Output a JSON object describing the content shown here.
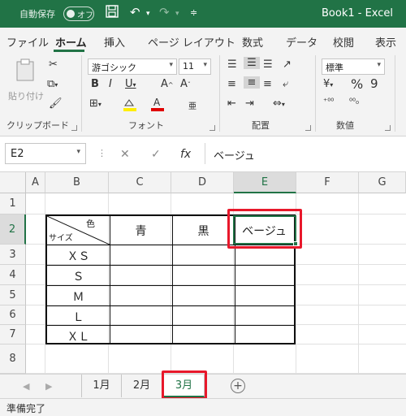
{
  "title_bar": {
    "autosave_label": "自動保存",
    "autosave_state": "オフ",
    "document_title": "Book1 - Excel"
  },
  "ribbon_tabs": [
    "ファイル",
    "ホーム",
    "挿入",
    "ページ レイアウト",
    "数式",
    "データ",
    "校閲",
    "表示"
  ],
  "ribbon": {
    "clipboard": {
      "paste_label": "貼り付け",
      "group_label": "クリップボード"
    },
    "font": {
      "font_name": "游ゴシック",
      "font_size": "11",
      "group_label": "フォント"
    },
    "alignment": {
      "group_label": "配置"
    },
    "number": {
      "format": "標準",
      "group_label": "数値"
    }
  },
  "formula_bar": {
    "name_box": "E2",
    "fx_label": "fx",
    "content": "ベージュ"
  },
  "grid": {
    "columns": [
      "A",
      "B",
      "C",
      "D",
      "E",
      "F",
      "G"
    ],
    "rows": [
      "1",
      "2",
      "3",
      "4",
      "5",
      "6",
      "7",
      "8"
    ],
    "selected_cell": "E2"
  },
  "table": {
    "diag_header_top": "色",
    "diag_header_bottom": "サイズ",
    "headers": [
      "青",
      "黒",
      "ベージュ"
    ],
    "sizes": [
      "ＸＳ",
      "Ｓ",
      "Ｍ",
      "Ｌ",
      "ＸＬ"
    ]
  },
  "sheet_tabs": [
    "1月",
    "2月",
    "3月"
  ],
  "active_sheet": "3月",
  "status_bar": {
    "text": "準備完了"
  },
  "colors": {
    "accent": "#217346",
    "highlight": "#e8182b"
  }
}
